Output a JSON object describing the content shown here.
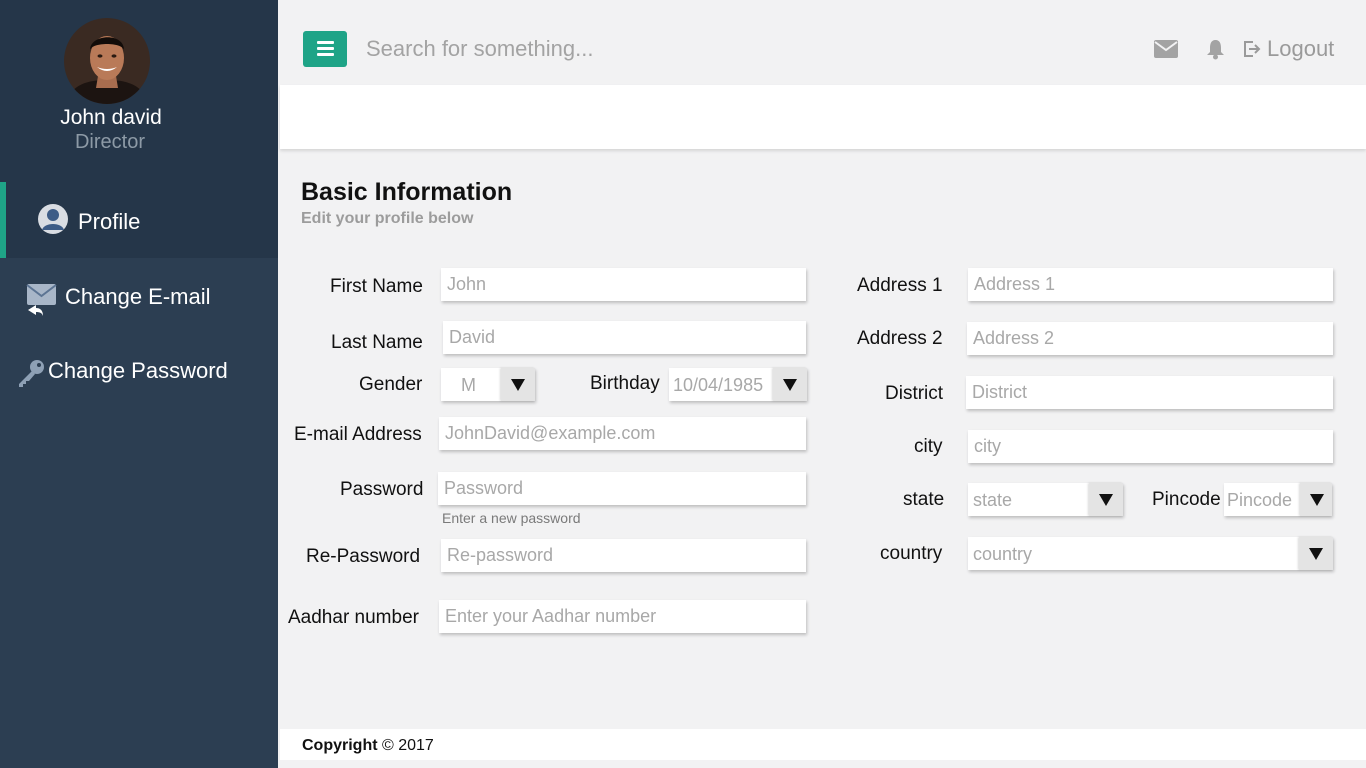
{
  "user": {
    "name": "John david",
    "role": "Director"
  },
  "sidebar": {
    "items": [
      {
        "label": "Profile",
        "icon": "user-icon",
        "active": true
      },
      {
        "label": "Change E-mail",
        "icon": "envelope-reply-icon",
        "active": false
      },
      {
        "label": "Change Password",
        "icon": "key-icon",
        "active": false
      }
    ]
  },
  "topbar": {
    "search_placeholder": "Search for something...",
    "logout_label": "Logout",
    "accent_color": "#1fa487"
  },
  "page": {
    "title": "Basic Information",
    "subtitle": "Edit your profile below"
  },
  "form": {
    "first_name": {
      "label": "First Name",
      "placeholder": "John"
    },
    "last_name": {
      "label": "Last Name",
      "placeholder": "David"
    },
    "gender": {
      "label": "Gender",
      "value": "M"
    },
    "birthday": {
      "label": "Birthday",
      "value": "10/04/1985"
    },
    "email": {
      "label": "E-mail Address",
      "placeholder": "JohnDavid@example.com"
    },
    "password": {
      "label": "Password",
      "placeholder": "Password",
      "hint": "Enter a new password"
    },
    "repassword": {
      "label": "Re-Password",
      "placeholder": "Re-password"
    },
    "aadhar": {
      "label": "Aadhar number",
      "placeholder": "Enter your Aadhar number"
    },
    "address1": {
      "label": "Address 1",
      "placeholder": "Address 1"
    },
    "address2": {
      "label": "Address 2",
      "placeholder": "Address 2"
    },
    "district": {
      "label": "District",
      "placeholder": "District"
    },
    "city": {
      "label": "city",
      "placeholder": "city"
    },
    "state": {
      "label": "state",
      "value": "state"
    },
    "pincode": {
      "label": "Pincode",
      "value": "Pincode"
    },
    "country": {
      "label": "country",
      "value": "country"
    }
  },
  "footer": {
    "copyright_label": "Copyright",
    "copyright_rest": "© 2017"
  }
}
